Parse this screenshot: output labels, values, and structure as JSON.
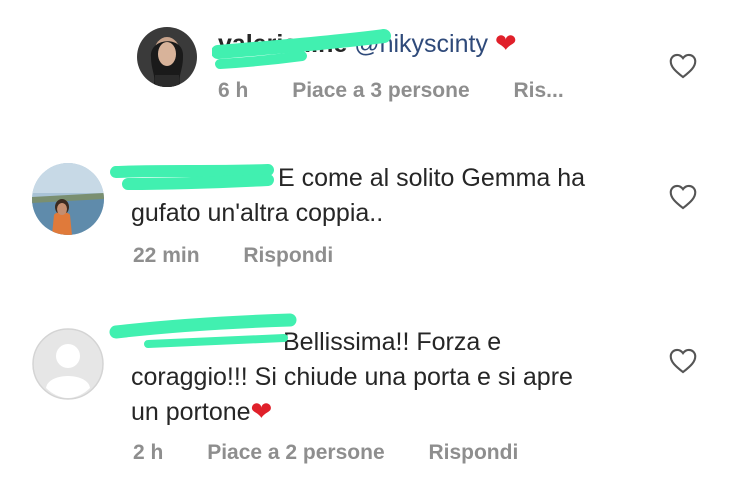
{
  "comments": [
    {
      "username": "valeria...ne",
      "mention": "@nikyscinty",
      "text": "",
      "heart": "❤",
      "time": "6 h",
      "likes": "Piace a 3 persone",
      "reply": "Ris..."
    },
    {
      "username": "...",
      "text_line1": "E come al solito Gemma ha",
      "text_line2": "gufato un'altra coppia..",
      "time": "22 min",
      "reply": "Rispondi"
    },
    {
      "username": "...",
      "text_line1": "Bellissima!! Forza e",
      "text_line2": "coraggio!!! Si chiude una porta e si apre",
      "text_line3": "un portone",
      "heart": "❤",
      "time": "2 h",
      "likes": "Piace a 2 persone",
      "reply": "Rispondi"
    }
  ],
  "icons": {
    "like": "heart-outline-icon",
    "avatar_default": "default-avatar-icon"
  },
  "colors": {
    "redaction": "#41f0b0",
    "heart": "#e0202a",
    "mention": "#2f4a7a",
    "meta": "#8e8e8e"
  }
}
